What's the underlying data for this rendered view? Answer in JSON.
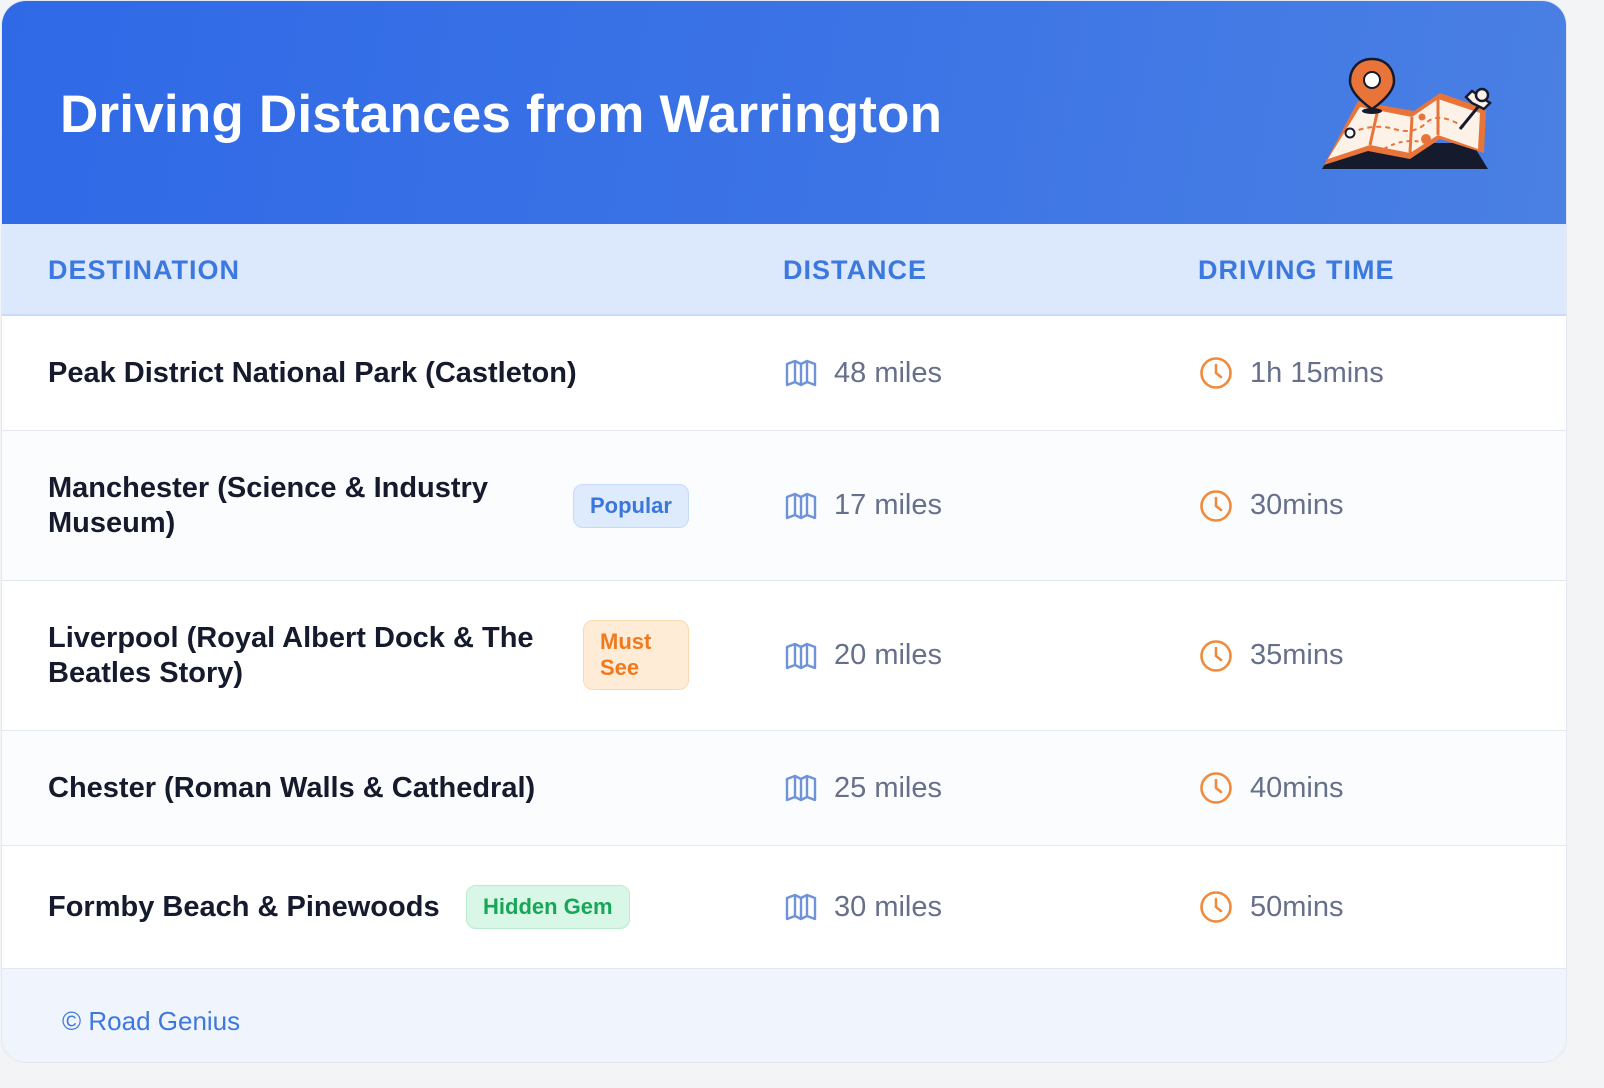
{
  "header": {
    "title": "Driving Distances from Warrington",
    "illustration_icon": "map-with-pin-icon"
  },
  "table": {
    "columns": [
      "DESTINATION",
      "DISTANCE",
      "DRIVING TIME"
    ],
    "rows": [
      {
        "destination": "Peak District National Park (Castleton)",
        "badge": "",
        "distance": "48 miles",
        "time": "1h 15mins"
      },
      {
        "destination": "Manchester (Science & Industry Museum)",
        "badge": "Popular",
        "distance": "17 miles",
        "time": "30mins"
      },
      {
        "destination": "Liverpool (Royal Albert Dock & The Beatles Story)",
        "badge": "Must See",
        "distance": "20 miles",
        "time": "35mins"
      },
      {
        "destination": "Chester (Roman Walls & Cathedral)",
        "badge": "",
        "distance": "25 miles",
        "time": "40mins"
      },
      {
        "destination": "Formby Beach & Pinewoods",
        "badge": "Hidden Gem",
        "distance": "30 miles",
        "time": "50mins"
      }
    ],
    "distance_icon": "map-icon",
    "time_icon": "clock-icon"
  },
  "footer": {
    "credit": "© Road Genius"
  },
  "colors": {
    "header_gradient_start": "#2f69e6",
    "header_gradient_end": "#4a80e3",
    "column_header_text": "#3b78e0",
    "badge_popular": "#3a76dc",
    "badge_must_see": "#f07a1e",
    "badge_hidden_gem": "#18a659",
    "clock_icon": "#f08a3c",
    "map_icon": "#6f93d8"
  }
}
